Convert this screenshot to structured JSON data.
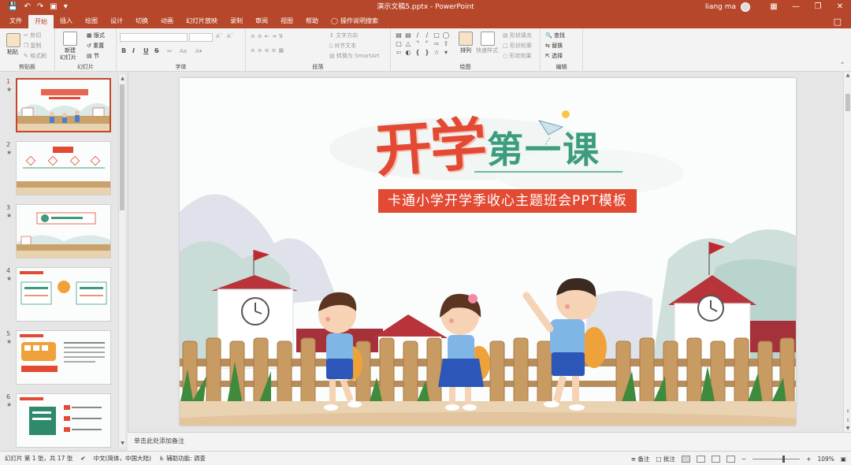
{
  "titlebar": {
    "title": "演示文稿5.pptx  -  PowerPoint",
    "user": "liang ma",
    "bg_color": "#b7472a",
    "qat_icons": [
      "save-icon",
      "undo-icon",
      "redo-icon",
      "start-slideshow-icon",
      "customize-qat-icon"
    ],
    "window_icons": [
      "ribbon-display-options-icon",
      "minimize-icon",
      "restore-icon",
      "close-icon"
    ]
  },
  "tabs": [
    "文件",
    "开始",
    "插入",
    "绘图",
    "设计",
    "切换",
    "动画",
    "幻灯片放映",
    "录制",
    "审阅",
    "视图",
    "帮助"
  ],
  "active_tab": "开始",
  "tell_me": "操作说明搜索",
  "ribbon": {
    "clipboard": {
      "label": "剪贴板",
      "paste": "粘贴",
      "cut": "剪切",
      "copy": "复制",
      "format_painter": "格式刷"
    },
    "slides": {
      "label": "幻灯片",
      "new_slide": "新建",
      "new_slide2": "幻灯片",
      "layout": "版式",
      "reset": "重置",
      "section": "节"
    },
    "font": {
      "label": "字体",
      "bold": "B",
      "italic": "I",
      "underline": "U",
      "strike": "S"
    },
    "paragraph": {
      "label": "段落",
      "text_direction": "文字方向",
      "align_text": "对齐文本",
      "smartart": "转换为 SmartArt"
    },
    "drawing": {
      "label": "绘图",
      "arrange": "排列",
      "quick_styles": "快速样式",
      "shape_fill": "形状填充",
      "shape_outline": "形状轮廓",
      "shape_effects": "形状效果"
    },
    "editing": {
      "label": "编辑",
      "find": "查找",
      "replace": "替换",
      "select": "选择"
    }
  },
  "thumbnails": [
    {
      "num": "1",
      "star": "★"
    },
    {
      "num": "2",
      "star": "★"
    },
    {
      "num": "3",
      "star": "★"
    },
    {
      "num": "4",
      "star": "★"
    },
    {
      "num": "5",
      "star": "★"
    },
    {
      "num": "6",
      "star": "★"
    }
  ],
  "slide": {
    "title_red": "开学",
    "title_green": "第一课",
    "subtitle": "卡通小学开学季收心主题班会PPT模板"
  },
  "notes": {
    "placeholder": "单击此处添加备注"
  },
  "statusbar": {
    "slide_count": "幻灯片 第 1 张，共 17 张",
    "language": "中文(简体，中国大陆)",
    "accessibility": "辅助功能: 调查",
    "notes": "备注",
    "comments": "批注",
    "zoom": "109%"
  },
  "colors": {
    "accent": "#b7472a",
    "title_red": "#e24a33",
    "title_green": "#3c9c7d"
  }
}
